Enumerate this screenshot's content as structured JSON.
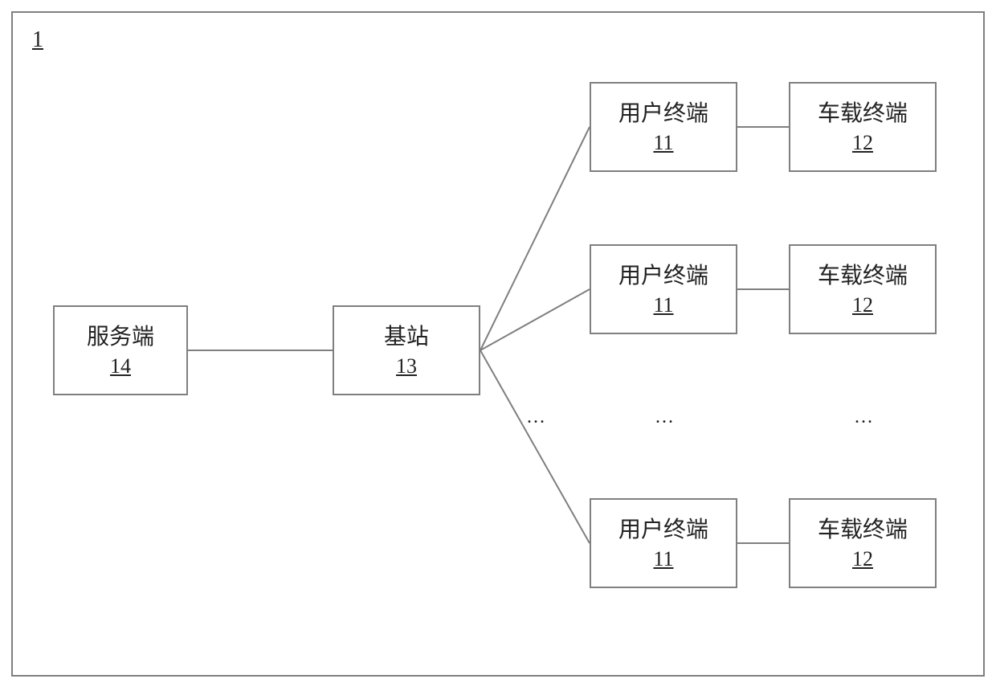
{
  "diagram": {
    "outer_label": "1",
    "server": {
      "label": "服务端",
      "num": "14"
    },
    "base_station": {
      "label": "基站",
      "num": "13"
    },
    "rows": [
      {
        "user_terminal": {
          "label": "用户终端",
          "num": "11"
        },
        "vehicle_terminal": {
          "label": "车载终端",
          "num": "12"
        }
      },
      {
        "user_terminal": {
          "label": "用户终端",
          "num": "11"
        },
        "vehicle_terminal": {
          "label": "车载终端",
          "num": "12"
        }
      },
      {
        "user_terminal": {
          "label": "用户终端",
          "num": "11"
        },
        "vehicle_terminal": {
          "label": "车载终端",
          "num": "12"
        }
      }
    ],
    "ellipsis": "..."
  }
}
